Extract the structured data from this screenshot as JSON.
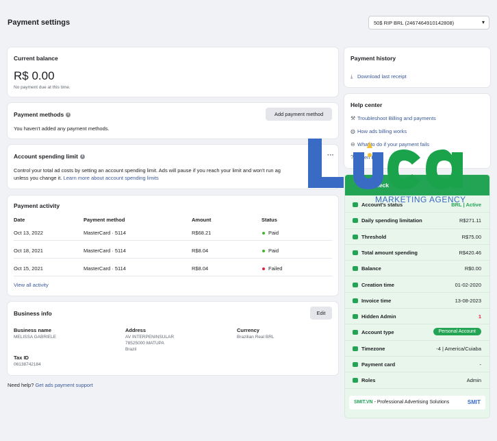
{
  "header": {
    "title": "Payment settings",
    "account_selector": "50$ RIP BRL (2467464910142808)"
  },
  "current_balance": {
    "title": "Current balance",
    "amount": "R$ 0.00",
    "note": "No payment due at this time."
  },
  "payment_methods": {
    "title": "Payment methods",
    "add_button": "Add payment method",
    "empty_text": "You haven't added any payment methods."
  },
  "spending_limit": {
    "title": "Account spending limit",
    "more": "···",
    "description": "Control your total ad costs by setting an account spending limit. Ads will pause if you reach your limit and won't run ag",
    "description2": "unless you change it.",
    "link": "Learn more about account spending limits"
  },
  "payment_activity": {
    "title": "Payment activity",
    "columns": [
      "Date",
      "Payment method",
      "Amount",
      "Status"
    ],
    "rows": [
      {
        "date": "Oct 13, 2022",
        "method": "MasterCard · 5114",
        "amount": "R$68.21",
        "status": "Paid",
        "status_color": "#42b72a"
      },
      {
        "date": "Oct 18, 2021",
        "method": "MasterCard · 5114",
        "amount": "R$8.04",
        "status": "Paid",
        "status_color": "#42b72a"
      },
      {
        "date": "Oct 15, 2021",
        "method": "MasterCard · 5114",
        "amount": "R$8.04",
        "status": "Failed",
        "status_color": "#e41e3f"
      }
    ],
    "view_all": "View all activity"
  },
  "business_info": {
    "title": "Business info",
    "edit_button": "Edit",
    "name_label": "Business name",
    "name_value": "MELISSA GABRIELE",
    "address_label": "Address",
    "address_lines": [
      "AV INTERPENINSULAR",
      "78525000 MATUPA",
      "Brazil"
    ],
    "currency_label": "Currency",
    "currency_value": "Brazilian Real BRL",
    "tax_label": "Tax ID",
    "tax_value": "06138742184"
  },
  "footer": {
    "help_text": "Need help?",
    "help_link": "Get ads payment support"
  },
  "payment_history": {
    "title": "Payment history",
    "link": "Download last receipt"
  },
  "help_center": {
    "title": "Help center",
    "items": [
      {
        "icon": "wrench-icon",
        "label": "Troubleshoot Billing and payments"
      },
      {
        "icon": "globe-icon",
        "label": "How ads billing works"
      },
      {
        "icon": "minus-circle-icon",
        "label": "What to do if your payment fails"
      },
      {
        "icon": "help-icon",
        "label": "Open H"
      }
    ]
  },
  "watermark": {
    "brand": "Luca",
    "tagline": "MARKETING AGENCY",
    "colors": {
      "blue": "#3a6bc4",
      "green": "#1aa34a",
      "yellow": "#f2c230"
    }
  },
  "checker_panel": {
    "title": "Ads Check",
    "rows": [
      {
        "label": "Account's status",
        "value": "BRL | Active",
        "value_color": "#23a455"
      },
      {
        "label": "Daily spending limitation",
        "value": "R$271.11"
      },
      {
        "label": "Threshold",
        "value": "R$75.00"
      },
      {
        "label": "Total amount spending",
        "value": "R$420.46"
      },
      {
        "label": "Balance",
        "value": "R$0.00"
      },
      {
        "label": "Creation time",
        "value": "01-02-2020"
      },
      {
        "label": "Invoice time",
        "value": "13-08-2023"
      },
      {
        "label": "Hidden Admin",
        "value": "1",
        "value_color": "#e41e3f"
      },
      {
        "label": "Account type",
        "value": "Personal Account",
        "pill": true
      },
      {
        "label": "Timezone",
        "value": "-4 | America/Cuiaba"
      },
      {
        "label": "Payment card",
        "value": "-"
      },
      {
        "label": "Roles",
        "value": "Admin"
      }
    ],
    "footer_brand": "SMIT.VN",
    "footer_text": " - Professional Advertising Solutions",
    "footer_logo": "SMIT"
  }
}
